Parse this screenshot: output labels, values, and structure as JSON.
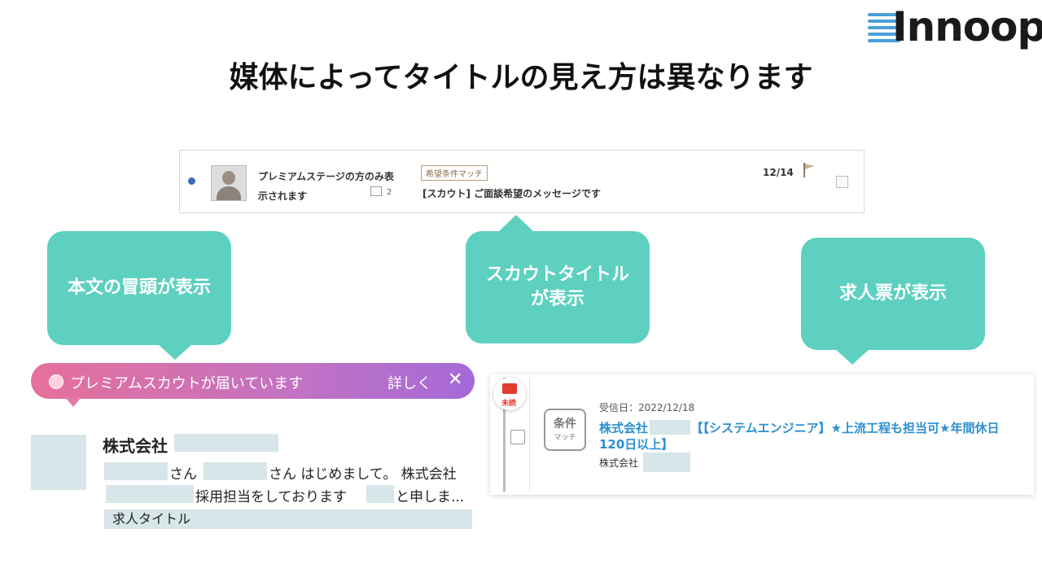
{
  "logo": {
    "text": "Innoop"
  },
  "title": "媒体によってタイトルの見え方は異なります",
  "message_row": {
    "sender_line1": "プレミアムステージの方のみ表",
    "sender_line2": "示されます",
    "thread_count": "2",
    "tag": "希望条件マッチ",
    "subject": "[スカウト] ご面談希望のメッセージです",
    "date": "12/14"
  },
  "callouts": {
    "left": "本文の冒頭が表示",
    "center_line1": "スカウトタイトル",
    "center_line2": "が表示",
    "right": "求人票が表示"
  },
  "banner": {
    "text": "プレミアムスカウトが届いています",
    "more": "詳しく",
    "close": "✕"
  },
  "message_card": {
    "company": "株式会社",
    "line1_a": "さん",
    "line1_b": "さん はじめまして。 株式会社",
    "line2_a": "採用担当をしております",
    "line2_b": "と申しま...",
    "job_title": "求人タイトル"
  },
  "job_card": {
    "unread": "未読",
    "cond_line1": "条件",
    "cond_line2": "マッチ",
    "received": "受信日：2022/12/18",
    "title": "株式会社　　　　【【システムエンジニア】★上流工程も担当可★年間休日120日以上】",
    "company": "株式会社"
  },
  "colors": {
    "teal": "#5dd0c0",
    "link_blue": "#2d8fd0",
    "mask": "#d7e6e8",
    "banner_start": "#e6709a",
    "banner_end": "#a46ad8"
  }
}
